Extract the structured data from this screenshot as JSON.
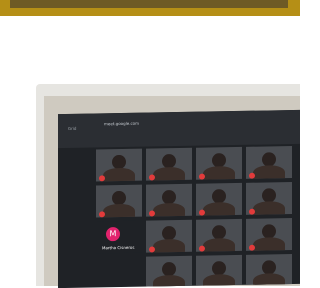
{
  "browser": {
    "tab_text": "Grid",
    "url": "meet.google.com"
  },
  "participants": [
    {
      "name": ""
    },
    {
      "name": ""
    },
    {
      "name": ""
    },
    {
      "name": ""
    },
    {
      "name": ""
    },
    {
      "name": ""
    },
    {
      "name": ""
    },
    {
      "name": ""
    },
    {
      "name": ""
    },
    {
      "name": ""
    },
    {
      "name": ""
    },
    {
      "name": ""
    },
    {
      "name": ""
    },
    {
      "name": ""
    },
    {
      "name": "Martha Cisneros",
      "avatar_letter": "M"
    }
  ],
  "colors": {
    "top_strip": "#b58f16",
    "screen_bg": "#1f2226",
    "avatar_pink": "#e2236d",
    "badge_red": "#e23b3b"
  }
}
